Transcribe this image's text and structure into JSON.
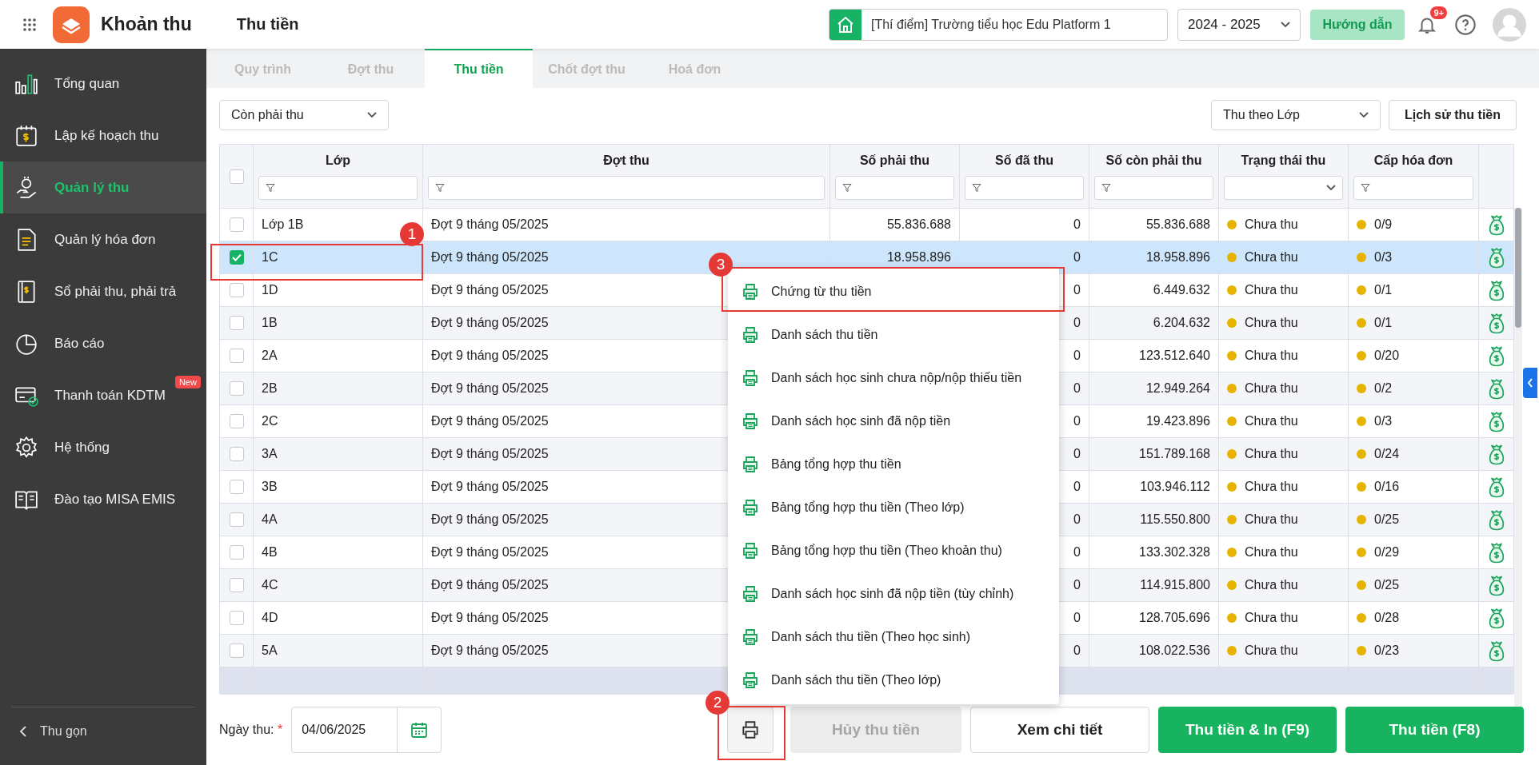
{
  "app": {
    "name": "Khoản thu",
    "page_title": "Thu tiền"
  },
  "header": {
    "school": "[Thí điểm] Trường tiểu học Edu Platform 1",
    "year": "2024 - 2025",
    "guide_button": "Hướng dẫn",
    "notification_badge": "9+"
  },
  "sidebar": {
    "items": [
      {
        "label": "Tổng quan",
        "selected": false
      },
      {
        "label": "Lập kế hoạch thu",
        "selected": false
      },
      {
        "label": "Quản lý thu",
        "selected": true
      },
      {
        "label": "Quản lý hóa đơn",
        "selected": false
      },
      {
        "label": "Sổ phải thu, phải trả",
        "selected": false
      },
      {
        "label": "Báo cáo",
        "selected": false
      },
      {
        "label": "Thanh toán KDTM",
        "selected": false,
        "badge": "New"
      },
      {
        "label": "Hệ thống",
        "selected": false
      },
      {
        "label": "Đào tạo MISA EMIS",
        "selected": false
      }
    ],
    "collapse": "Thu gọn"
  },
  "tabs": [
    {
      "label": "Quy trình",
      "selected": false
    },
    {
      "label": "Đợt thu",
      "selected": false
    },
    {
      "label": "Thu tiền",
      "selected": true
    },
    {
      "label": "Chốt đợt thu",
      "selected": false
    },
    {
      "label": "Hoá đơn",
      "selected": false
    }
  ],
  "filters": {
    "status_select": "Còn phải thu",
    "mode_select": "Thu theo Lớp",
    "history_button": "Lịch sử thu tiền"
  },
  "table": {
    "all_checked": false,
    "columns": [
      {
        "label": "Lớp",
        "kind": "text"
      },
      {
        "label": "Đợt thu",
        "kind": "text"
      },
      {
        "label": "Số phải thu",
        "kind": "text"
      },
      {
        "label": "Số đã thu",
        "kind": "text"
      },
      {
        "label": "Số còn phải thu",
        "kind": "text"
      },
      {
        "label": "Trạng thái thu",
        "kind": "select"
      },
      {
        "label": "Cấp hóa đơn",
        "kind": "text"
      }
    ],
    "rows": [
      {
        "selected": false,
        "class": "Lớp 1B",
        "period": "Đợt 9 tháng 05/2025",
        "due": "55.836.688",
        "paid": "0",
        "remaining": "55.836.688",
        "status": "Chưa thu",
        "invoices": "0/9"
      },
      {
        "selected": true,
        "class": "1C",
        "period": "Đợt 9 tháng 05/2025",
        "due": "18.958.896",
        "paid": "0",
        "remaining": "18.958.896",
        "status": "Chưa thu",
        "invoices": "0/3"
      },
      {
        "selected": false,
        "class": "1D",
        "period": "Đợt 9 tháng 05/2025",
        "paid": "0",
        "remaining": "6.449.632",
        "status": "Chưa thu",
        "invoices": "0/1"
      },
      {
        "selected": false,
        "class": "1B",
        "period": "Đợt 9 tháng 05/2025",
        "paid": "0",
        "remaining": "6.204.632",
        "status": "Chưa thu",
        "invoices": "0/1"
      },
      {
        "selected": false,
        "class": "2A",
        "period": "Đợt 9 tháng 05/2025",
        "paid": "0",
        "remaining": "123.512.640",
        "status": "Chưa thu",
        "invoices": "0/20"
      },
      {
        "selected": false,
        "class": "2B",
        "period": "Đợt 9 tháng 05/2025",
        "paid": "0",
        "remaining": "12.949.264",
        "status": "Chưa thu",
        "invoices": "0/2"
      },
      {
        "selected": false,
        "class": "2C",
        "period": "Đợt 9 tháng 05/2025",
        "paid": "0",
        "remaining": "19.423.896",
        "status": "Chưa thu",
        "invoices": "0/3"
      },
      {
        "selected": false,
        "class": "3A",
        "period": "Đợt 9 tháng 05/2025",
        "paid": "0",
        "remaining": "151.789.168",
        "status": "Chưa thu",
        "invoices": "0/24"
      },
      {
        "selected": false,
        "class": "3B",
        "period": "Đợt 9 tháng 05/2025",
        "paid": "0",
        "remaining": "103.946.112",
        "status": "Chưa thu",
        "invoices": "0/16"
      },
      {
        "selected": false,
        "class": "4A",
        "period": "Đợt 9 tháng 05/2025",
        "paid": "0",
        "remaining": "115.550.800",
        "status": "Chưa thu",
        "invoices": "0/25"
      },
      {
        "selected": false,
        "class": "4B",
        "period": "Đợt 9 tháng 05/2025",
        "paid": "0",
        "remaining": "133.302.328",
        "status": "Chưa thu",
        "invoices": "0/29"
      },
      {
        "selected": false,
        "class": "4C",
        "period": "Đợt 9 tháng 05/2025",
        "paid": "0",
        "remaining": "114.915.800",
        "status": "Chưa thu",
        "invoices": "0/25"
      },
      {
        "selected": false,
        "class": "4D",
        "period": "Đợt 9 tháng 05/2025",
        "paid": "0",
        "remaining": "128.705.696",
        "status": "Chưa thu",
        "invoices": "0/28"
      },
      {
        "selected": false,
        "class": "5A",
        "period": "Đợt 9 tháng 05/2025",
        "paid": "0",
        "remaining": "108.022.536",
        "status": "Chưa thu",
        "invoices": "0/23"
      }
    ]
  },
  "print_menu": {
    "items": [
      "Chứng từ thu tiền",
      "Danh sách thu tiền",
      "Danh sách học sinh chưa nộp/nộp thiếu tiền",
      "Danh sách học sinh đã nộp tiền",
      "Bảng tổng hợp thu tiền",
      "Bảng tổng hợp thu tiền (Theo lớp)",
      "Bảng tổng hợp thu tiền (Theo khoản thu)",
      "Danh sách học sinh đã nộp tiền (tùy chỉnh)",
      "Danh sách thu tiền (Theo học sinh)",
      "Danh sách thu tiền (Theo lớp)"
    ]
  },
  "footer": {
    "date_label": "Ngày thu:",
    "required_mark": "*",
    "date": "04/06/2025",
    "cancel_button": {
      "label": "Hủy thu tiền",
      "disabled": true
    },
    "detail_button": "Xem chi tiết",
    "pay_print_button": "Thu tiền & In (F9)",
    "pay_button": "Thu tiền (F8)"
  },
  "annotations": [
    "1",
    "2",
    "3"
  ]
}
